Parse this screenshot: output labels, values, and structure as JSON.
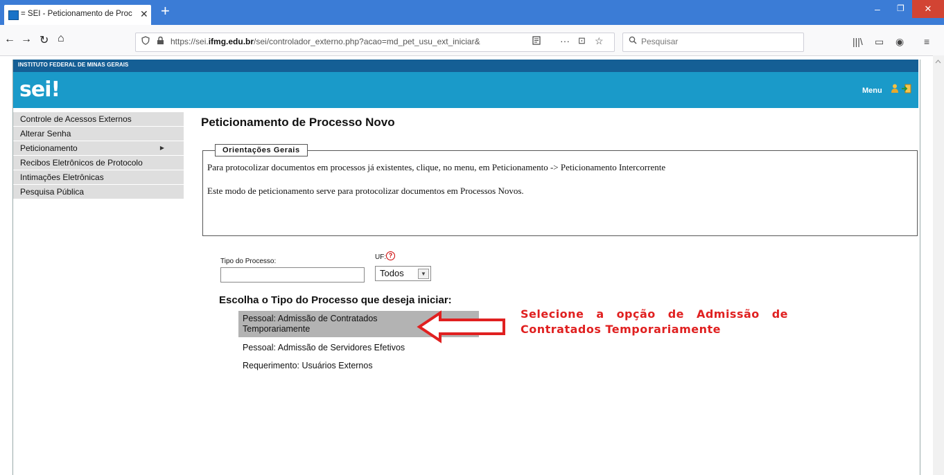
{
  "browser": {
    "tab_title": "= SEI - Peticionamento de Proc",
    "tab_close": "✕",
    "new_tab": "+",
    "window_controls": {
      "minimize": "–",
      "maximize": "❐",
      "close": "✕"
    },
    "nav": {
      "back": "←",
      "forward": "→",
      "reload": "↻",
      "home": "⌂"
    },
    "url_prefix": "https://sei.",
    "url_domain": "ifmg.edu.br",
    "url_suffix": "/sei/controlador_externo.php?acao=md_pet_usu_ext_iniciar&",
    "url_icons": {
      "more": "···",
      "pocket": "⊡",
      "bookmark": "☆"
    },
    "search_placeholder": "Pesquisar",
    "toolbar_icons": {
      "library": "|||\\",
      "sidebar": "▭",
      "account": "◉",
      "menu": "≡"
    }
  },
  "sei": {
    "institution": "INSTITUTO FEDERAL DE MINAS GERAIS",
    "logo": "sei!",
    "menu_label": "Menu"
  },
  "sidebar": {
    "items": [
      {
        "label": "Controle de Acessos Externos",
        "has_submenu": false
      },
      {
        "label": "Alterar Senha",
        "has_submenu": false
      },
      {
        "label": "Peticionamento",
        "has_submenu": true
      },
      {
        "label": "Recibos Eletrônicos de Protocolo",
        "has_submenu": false
      },
      {
        "label": "Intimações Eletrônicas",
        "has_submenu": false
      },
      {
        "label": "Pesquisa Pública",
        "has_submenu": false
      }
    ],
    "submenu_arrow": "▶"
  },
  "main": {
    "title": "Peticionamento de Processo Novo",
    "orientacoes": {
      "legend": "Orientações Gerais",
      "line1": "Para protocolizar documentos em processos já existentes, clique, no menu, em Peticionamento -> Peticionamento Intercorrente",
      "line2": "Este modo de peticionamento serve para protocolizar documentos em Processos Novos."
    },
    "filter": {
      "tipo_label": "Tipo do Processo:",
      "tipo_value": "",
      "uf_label": "UF:",
      "uf_help": "?",
      "uf_selected": "Todos",
      "uf_arrow": "▼"
    },
    "choose_title": "Escolha o Tipo do Processo que deseja iniciar:",
    "options": [
      "Pessoal: Admissão de Contratados Temporariamente",
      "Pessoal: Admissão de Servidores Efetivos",
      "Requerimento: Usuários Externos"
    ],
    "annotation": "Selecione a opção de Admissão de Contratados Temporariamente"
  },
  "colors": {
    "browser_tabbar": "#3b7cd6",
    "sei_header": "#1a9ac9",
    "sei_topstrip": "#155f95",
    "annotation": "#e02020",
    "selected_option": "#b3b3b3"
  }
}
